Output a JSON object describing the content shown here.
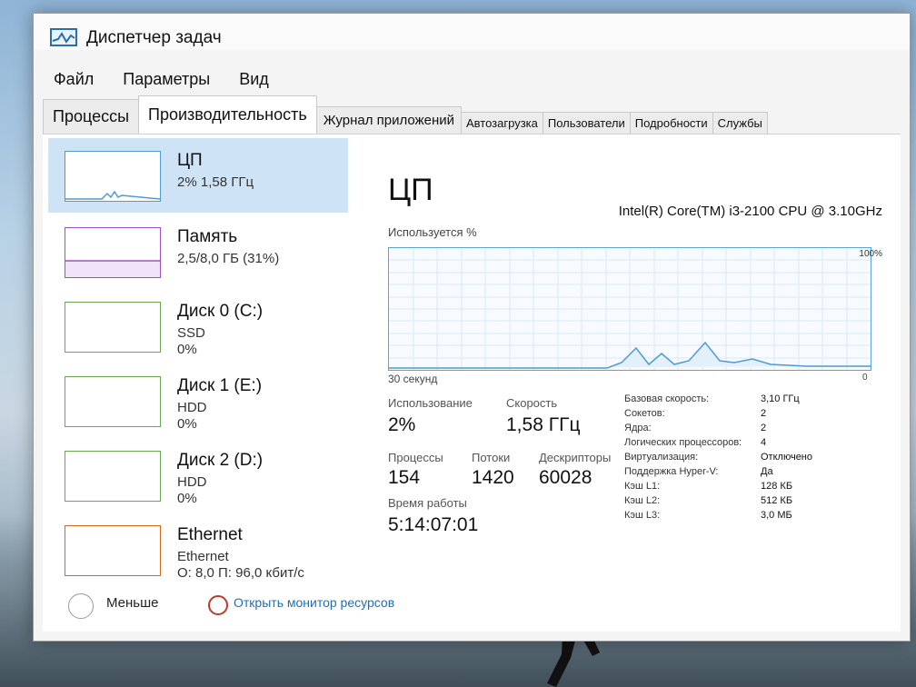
{
  "window": {
    "title": "Диспетчер задач"
  },
  "menu": [
    "Файл",
    "Параметры",
    "Вид"
  ],
  "tabs": [
    "Процессы",
    "Производительность",
    "Журнал приложений",
    "Автозагрузка",
    "Пользователи",
    "Подробности",
    "Службы"
  ],
  "sidebar": [
    {
      "title": "ЦП",
      "line1": "2%  1,58 ГГц",
      "line2": ""
    },
    {
      "title": "Память",
      "line1": "2,5/8,0 ГБ (31%)",
      "line2": ""
    },
    {
      "title": "Диск 0 (C:)",
      "line1": "SSD",
      "line2": "0%"
    },
    {
      "title": "Диск 1 (E:)",
      "line1": "HDD",
      "line2": "0%"
    },
    {
      "title": "Диск 2 (D:)",
      "line1": "HDD",
      "line2": "0%"
    },
    {
      "title": "Ethernet",
      "line1": "Ethernet",
      "line2": "О: 8,0  П: 96,0 кбит/с"
    }
  ],
  "main": {
    "title": "ЦП",
    "model": "Intel(R) Core(TM) i3-2100 CPU @ 3.10GHz",
    "usage_label": "Используется %",
    "pct_max": "100%",
    "time_label": "30 секунд",
    "zero_label": "0"
  },
  "stats": {
    "usage_lbl": "Использование",
    "usage_val": "2%",
    "speed_lbl": "Скорость",
    "speed_val": "1,58 ГГц",
    "proc_lbl": "Процессы",
    "proc_val": "154",
    "threads_lbl": "Потоки",
    "threads_val": "1420",
    "handles_lbl": "Дескрипторы",
    "handles_val": "60028",
    "uptime_lbl": "Время работы",
    "uptime_val": "5:14:07:01"
  },
  "specs": [
    {
      "k": "Базовая скорость:",
      "v": "3,10 ГГц"
    },
    {
      "k": "Сокетов:",
      "v": "2"
    },
    {
      "k": "Ядра:",
      "v": "2"
    },
    {
      "k": "Логических процессоров:",
      "v": "4"
    },
    {
      "k": "Виртуализация:",
      "v": "Отключено"
    },
    {
      "k": "Поддержка Hyper-V:",
      "v": "Да"
    },
    {
      "k": "Кэш L1:",
      "v": "128 КБ"
    },
    {
      "k": "Кэш L2:",
      "v": "512 КБ"
    },
    {
      "k": "Кэш L3:",
      "v": "3,0 МБ"
    }
  ],
  "footer": {
    "fewer": "Меньше",
    "resource_monitor": "Открыть монитор ресурсов"
  },
  "colors": {
    "cpu": "#4f9bd3",
    "memory": "#a04fc4",
    "disk": "#6aa84f",
    "ethernet": "#d2691e"
  }
}
